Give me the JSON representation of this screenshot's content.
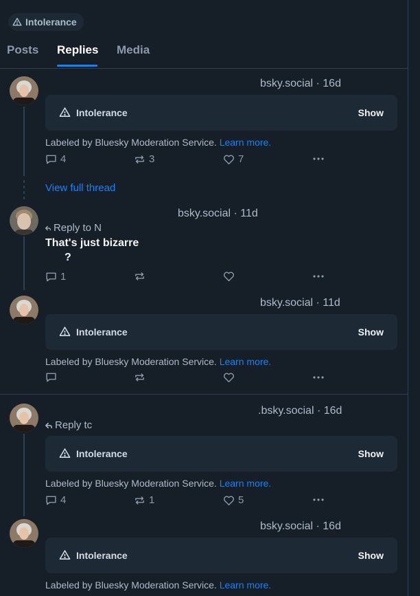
{
  "label_pill": {
    "text": "Intolerance"
  },
  "tabs": [
    "Posts",
    "Replies",
    "Media"
  ],
  "moderation": {
    "label": "Intolerance",
    "show": "Show",
    "labeled_by": "Labeled by Bluesky Moderation Service.",
    "learn_more": "Learn more."
  },
  "posts": [
    {
      "handle_time": "bsky.social · 16d",
      "reply_count": "4",
      "repost_count": "3",
      "like_count": "7"
    },
    {
      "handle_time": "bsky.social · 11d",
      "reply_to": "Reply to N",
      "text": "That's just bizarre",
      "text_cont": "?",
      "reply_count": "1",
      "repost_count": "",
      "like_count": ""
    },
    {
      "handle_time": "bsky.social · 11d",
      "reply_count": "",
      "repost_count": "",
      "like_count": ""
    },
    {
      "handle_time": ".bsky.social · 16d",
      "reply_to": "Reply tc",
      "reply_count": "4",
      "repost_count": "1",
      "like_count": "5"
    },
    {
      "handle_time": "bsky.social · 16d"
    }
  ],
  "view_full_thread": "View full thread",
  "colors": {
    "background": "#161e27",
    "card": "#1e2936",
    "accent": "#1083fe",
    "muted": "#aebbc9",
    "border": "#2e4052"
  }
}
